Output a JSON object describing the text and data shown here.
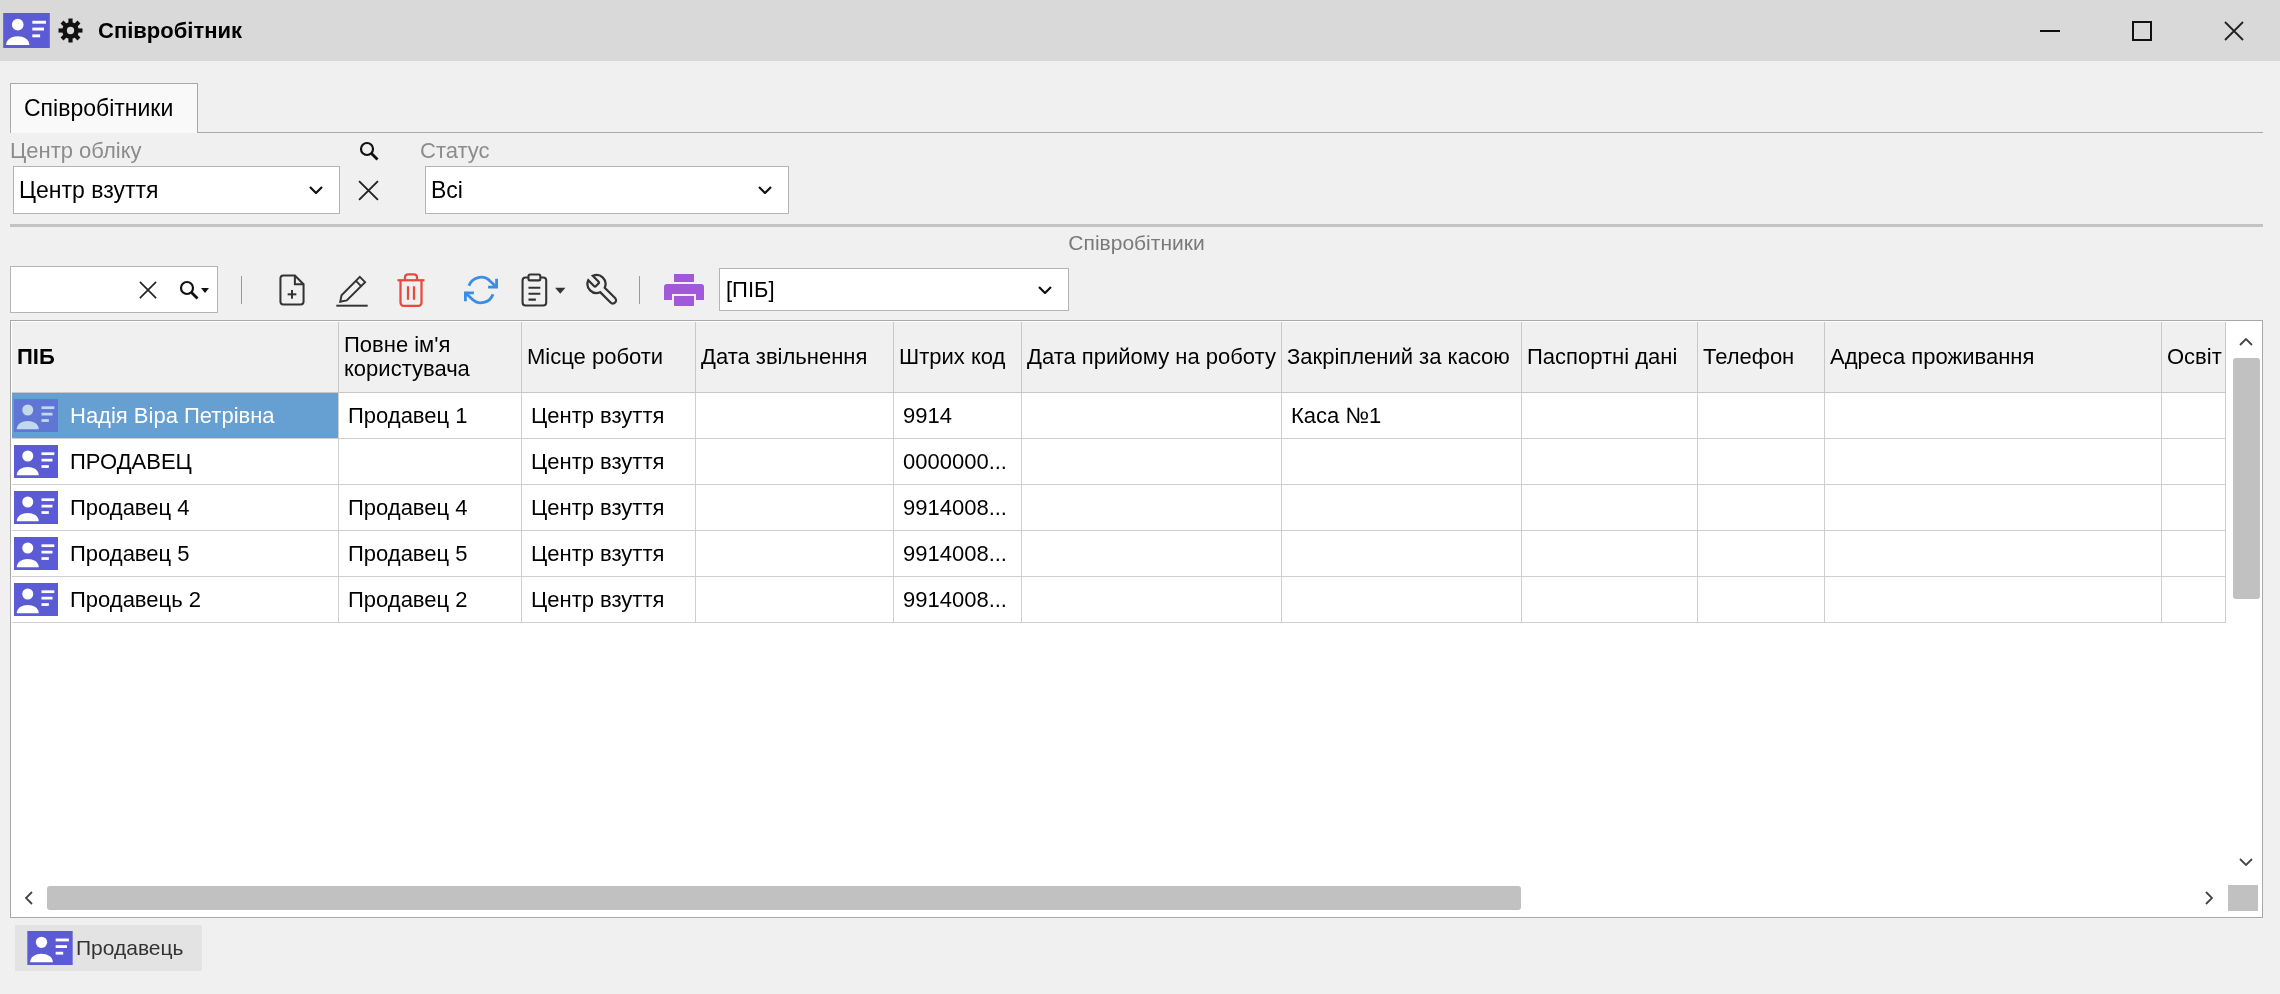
{
  "window": {
    "title": "Співробітник"
  },
  "tabs": [
    {
      "label": "Співробітники",
      "selected": true
    }
  ],
  "filters": [
    {
      "label": "Центр обліку",
      "value": "Центр взуття"
    },
    {
      "label": "Статус",
      "value": "Всі"
    }
  ],
  "section_title": "Співробітники",
  "toolbar": {
    "view_field": {
      "value": "[ПІБ]"
    }
  },
  "table": {
    "columns": [
      {
        "label": "ПІБ",
        "sorted": true
      },
      {
        "label": "Повне ім'я користувача",
        "sorted": false
      },
      {
        "label": "Місце роботи",
        "sorted": false
      },
      {
        "label": "Дата звільнення",
        "sorted": false
      },
      {
        "label": "Штрих код",
        "sorted": false
      },
      {
        "label": "Дата прийому на роботу",
        "sorted": false
      },
      {
        "label": "Закріплений за касою",
        "sorted": false
      },
      {
        "label": "Паспортні дані",
        "sorted": false
      },
      {
        "label": "Телефон",
        "sorted": false
      },
      {
        "label": "Адреса проживання",
        "sorted": false
      },
      {
        "label": "Освіт",
        "sorted": false
      }
    ],
    "rows": [
      {
        "selected": true,
        "name": "Надія Віра Петрівна",
        "user_full_name": "Продавец 1",
        "workplace": "Центр взуття",
        "barcode": "9914",
        "cash_register": "Каса №1"
      },
      {
        "selected": false,
        "name": "ПРОДАВЕЦ",
        "workplace": "Центр взуття",
        "barcode": "0000000..."
      },
      {
        "selected": false,
        "name": "Продавец 4",
        "user_full_name": "Продавец 4",
        "workplace": "Центр взуття",
        "barcode": "9914008..."
      },
      {
        "selected": false,
        "name": "Продавец 5",
        "user_full_name": "Продавец 5",
        "workplace": "Центр взуття",
        "barcode": "9914008..."
      },
      {
        "selected": false,
        "name": "Продавець 2",
        "user_full_name": "Продавец 2",
        "workplace": "Центр взуття",
        "barcode": "9914008..."
      }
    ]
  },
  "footer_button": {
    "label": "Продавець"
  }
}
